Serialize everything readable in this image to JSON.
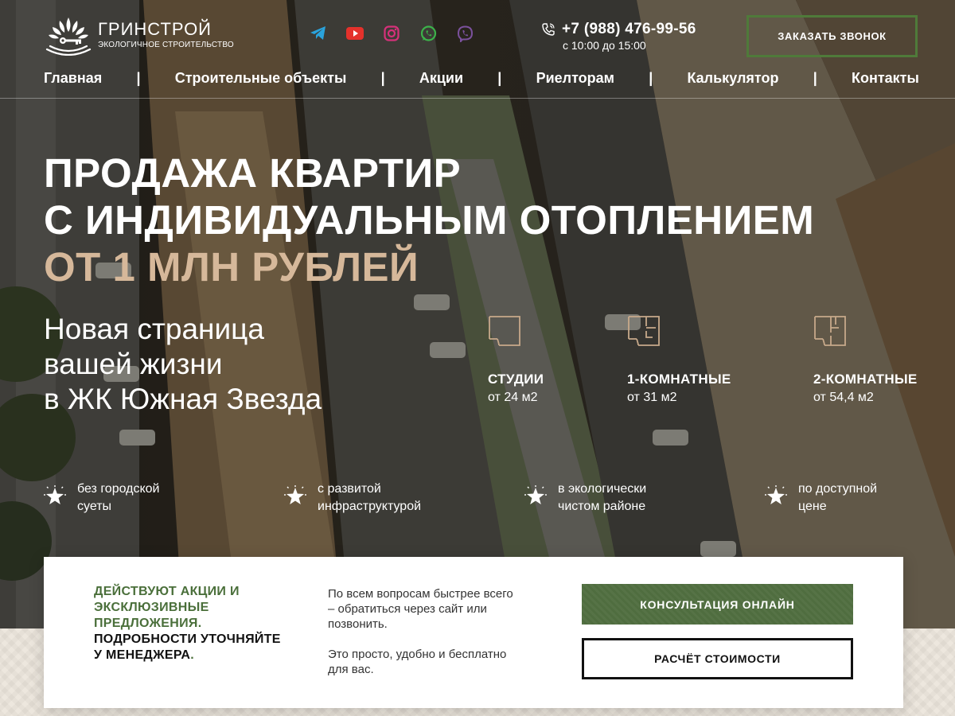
{
  "brand": {
    "name": "ГРИНСТРОЙ",
    "tagline": "ЭКОЛОГИЧНОЕ СТРОИТЕЛЬСТВО",
    "accent_color": "#4f7a3a"
  },
  "socials": [
    {
      "icon": "telegram-icon",
      "color": "#2aa3dc"
    },
    {
      "icon": "youtube-icon",
      "color": "#e4312b"
    },
    {
      "icon": "instagram-icon",
      "color": "#d6317a"
    },
    {
      "icon": "whatsapp-icon",
      "color": "#3cb34a"
    },
    {
      "icon": "viber-icon",
      "color": "#7b519d"
    }
  ],
  "contact": {
    "phone": "+7 (988) 476-99-56",
    "hours": "с 10:00 до 15:00",
    "phone_icon": "phone-icon"
  },
  "header": {
    "callback_label": "ЗАКАЗАТЬ ЗВОНОК"
  },
  "nav": {
    "items": [
      "Главная",
      "Строительные объекты",
      "Акции",
      "Риелторам",
      "Калькулятор",
      "Контакты"
    ],
    "separator": "|"
  },
  "hero": {
    "title_line1": "ПРОДАЖА КВАРТИР",
    "title_line2": "С ИНДИВИДУАЛЬНЫМ ОТОПЛЕНИЕМ",
    "title_line3": "ОТ 1 МЛН РУБЛЕЙ",
    "title_accent_color": "#d6b89a",
    "subtitle_line1": "Новая страница",
    "subtitle_line2": "вашей жизни",
    "subtitle_line3": "в ЖК Южная Звезда"
  },
  "apartments": [
    {
      "title": "СТУДИИ",
      "area": "от 24 м2",
      "icon": "studio-plan-icon"
    },
    {
      "title": "1-КОМНАТНЫЕ",
      "area": "от 31 м2",
      "icon": "one-room-plan-icon"
    },
    {
      "title": "2-КОМНАТНЫЕ",
      "area": "от 54,4 м2",
      "icon": "two-room-plan-icon"
    }
  ],
  "features": [
    {
      "line1": "без городской",
      "line2": "суеты",
      "icon": "star-icon"
    },
    {
      "line1": "с развитой",
      "line2": "инфраструктурой",
      "icon": "star-icon"
    },
    {
      "line1": "в экологически",
      "line2": "чистом районе",
      "icon": "star-icon"
    },
    {
      "line1": "по доступной",
      "line2": "цене",
      "icon": "star-icon"
    }
  ],
  "card": {
    "promo_green": "ДЕЙСТВУЮТ АКЦИИ И ЭКСКЛЮЗИВНЫЕ ПРЕДЛОЖЕНИЯ.",
    "promo_black": "ПОДРОБНОСТИ УТОЧНЯЙТЕ У МЕНЕДЖЕРА",
    "promo_dot": ".",
    "info_p1": "По всем вопросам быстрее всего – обратиться через сайт или позвонить.",
    "info_p2": "Это просто, удобно и бесплатно для вас.",
    "consult_label": "КОНСУЛЬТАЦИЯ ОНЛАЙН",
    "calc_label": "РАСЧЁТ СТОИМОСТИ",
    "consult_color": "#4f6d3f"
  }
}
